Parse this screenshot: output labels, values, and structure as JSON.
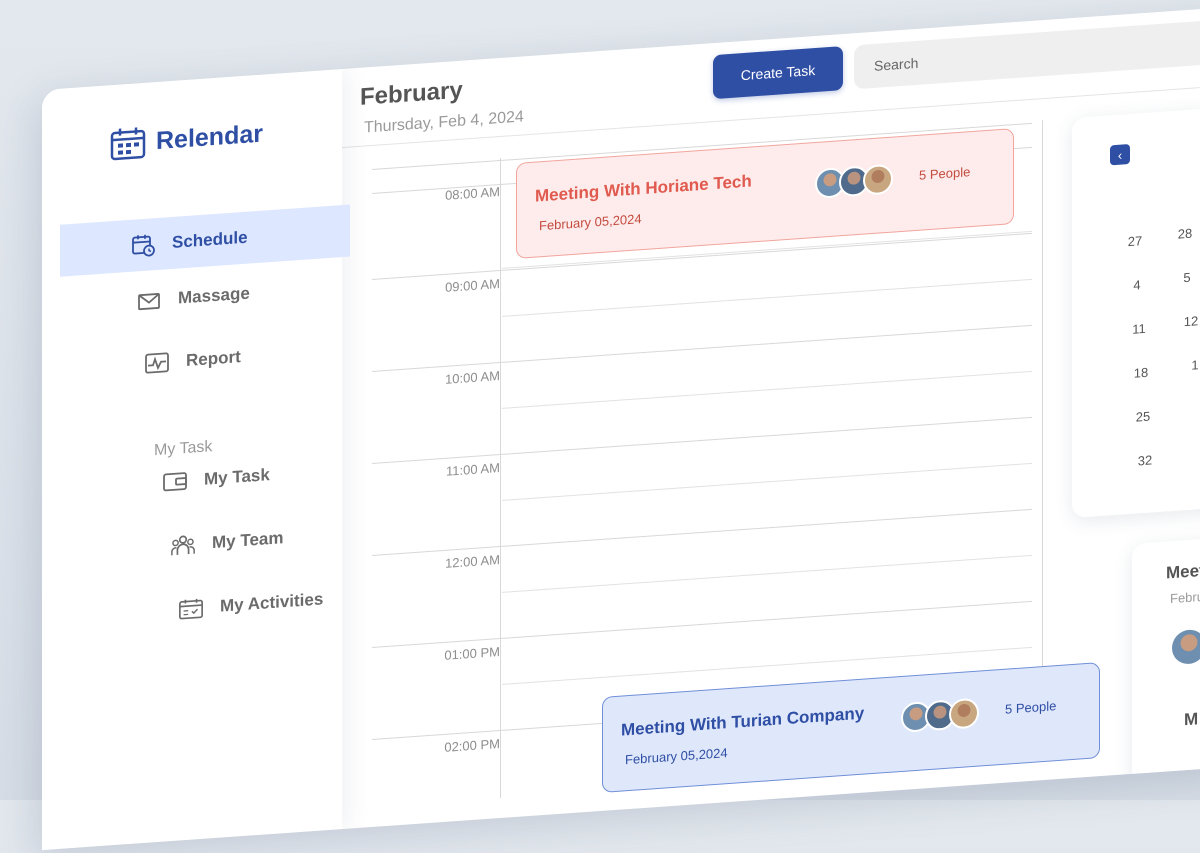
{
  "app": {
    "name": "Relendar",
    "brand_color": "#2f4fa5"
  },
  "sidebar": {
    "items": [
      {
        "label": "Schedule",
        "icon": "calendar-clock-icon",
        "active": true
      },
      {
        "label": "Massage",
        "icon": "mail-icon"
      },
      {
        "label": "Report",
        "icon": "chart-icon"
      }
    ],
    "section_label": "My Task",
    "sub_items": [
      {
        "label": "My Task",
        "icon": "wallet-icon"
      },
      {
        "label": "My Team",
        "icon": "team-icon"
      },
      {
        "label": "My Activities",
        "icon": "calendar-check-icon"
      }
    ]
  },
  "header": {
    "month": "February",
    "date": "Thursday, Feb 4, 2024",
    "create_label": "Create Task",
    "search_placeholder": "Search"
  },
  "timeline": {
    "hours": [
      "08:00 AM",
      "09:00 AM",
      "10:00 AM",
      "11:00 AM",
      "12:00 AM",
      "01:00 PM",
      "02:00 PM"
    ]
  },
  "events": [
    {
      "title": "Meeting With Horiane Tech",
      "date": "February 05,2024",
      "people": "5 People",
      "color": "red"
    },
    {
      "title": "Meeting With Turian Company",
      "date": "February 05,2024",
      "people": "5 People",
      "color": "blue"
    }
  ],
  "mini_calendar": {
    "prev_icon": "chevron-left-icon",
    "col1": [
      "27",
      "4",
      "11",
      "18",
      "25",
      "32"
    ],
    "col2": [
      "28",
      "5",
      "12",
      "1"
    ]
  },
  "side_meeting": {
    "title": "Meet",
    "sub": "Febru",
    "extra": "M"
  }
}
